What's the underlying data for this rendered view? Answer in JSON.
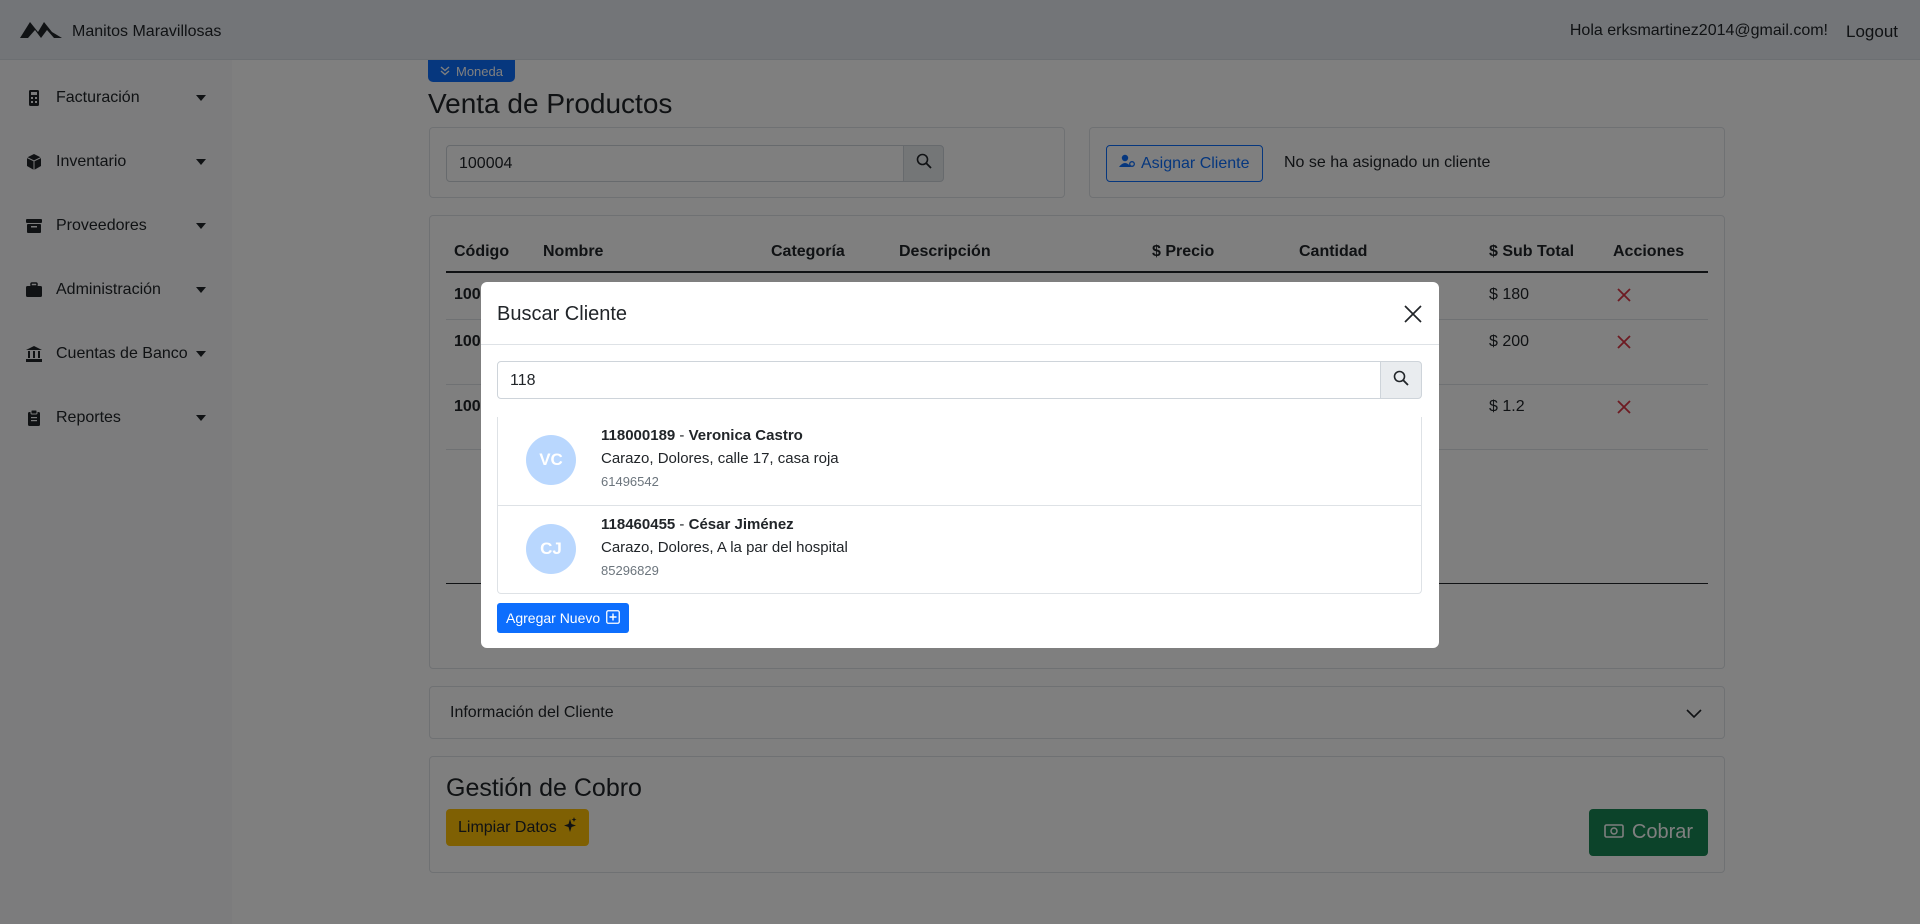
{
  "app": {
    "brand": "Manitos Maravillosas"
  },
  "header": {
    "greeting": "Hola erksmartinez2014@gmail.com!",
    "logout": "Logout"
  },
  "sidebar": {
    "items": [
      {
        "label": "Facturación",
        "icon": "calculator-icon"
      },
      {
        "label": "Inventario",
        "icon": "box-icon"
      },
      {
        "label": "Proveedores",
        "icon": "archive-icon"
      },
      {
        "label": "Administración",
        "icon": "briefcase-icon"
      },
      {
        "label": "Cuentas de Banco",
        "icon": "bank-icon"
      },
      {
        "label": "Reportes",
        "icon": "clipboard-icon"
      }
    ]
  },
  "page": {
    "moneda_label": "Moneda",
    "title": "Venta de Productos",
    "product_search_value": "100004",
    "assign_client_label": "Asignar Cliente",
    "no_client_text": "No se ha asignado un cliente"
  },
  "table": {
    "headers": [
      "Código",
      "Nombre",
      "Categoría",
      "Descripción",
      "$ Precio",
      "Cantidad",
      "$ Sub Total",
      "Acciones"
    ],
    "rows": [
      {
        "code": "100",
        "subtotal": "$ 180"
      },
      {
        "code": "100",
        "subtotal": "$ 200"
      },
      {
        "code": "100",
        "subtotal": "$ 1.2"
      }
    ]
  },
  "client_info": {
    "label": "Información del Cliente"
  },
  "cobro": {
    "title": "Gestión de Cobro",
    "clear_label": "Limpiar Datos",
    "charge_label": "Cobrar"
  },
  "modal": {
    "title": "Buscar Cliente",
    "search_value": "118",
    "results": [
      {
        "initials": "VC",
        "id": "118000189",
        "separator": " - ",
        "name": "Veronica Castro",
        "address": "Carazo, Dolores, calle 17, casa roja",
        "phone": "61496542"
      },
      {
        "initials": "CJ",
        "id": "118460455",
        "separator": " - ",
        "name": "César Jiménez",
        "address": "Carazo, Dolores, A la par del hospital",
        "phone": "85296829"
      }
    ],
    "add_new_label": "Agregar Nuevo"
  },
  "colors": {
    "primary": "#0d6efd",
    "success": "#198754",
    "warning": "#ffc107",
    "danger": "#dc3545",
    "avatar": "#b9d7fe"
  }
}
